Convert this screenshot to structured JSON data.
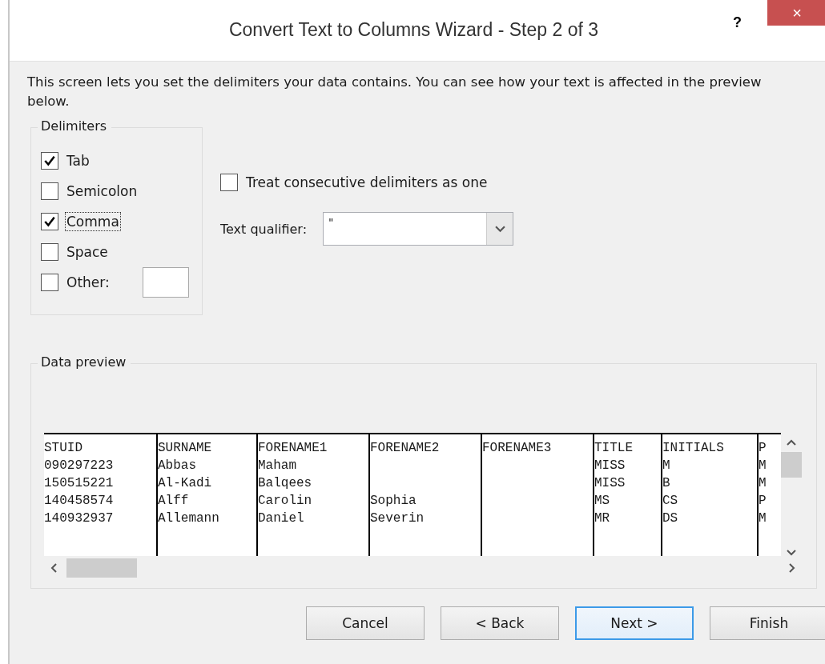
{
  "window": {
    "title": "Convert Text to Columns Wizard - Step 2 of 3",
    "help": "?",
    "close": "×"
  },
  "intro": "This screen lets you set the delimiters your data contains.  You can see how your text is affected in the preview below.",
  "delimiters": {
    "legend": "Delimiters",
    "items": [
      {
        "label": "Tab",
        "checked": true,
        "focused": false
      },
      {
        "label": "Semicolon",
        "checked": false,
        "focused": false
      },
      {
        "label": "Comma",
        "checked": true,
        "focused": true
      },
      {
        "label": "Space",
        "checked": false,
        "focused": false
      },
      {
        "label": "Other:",
        "checked": false,
        "focused": false
      }
    ]
  },
  "consecutive": {
    "label": "Treat consecutive delimiters as one",
    "checked": false
  },
  "qualifier": {
    "label": "Text qualifier:",
    "value": "\""
  },
  "preview": {
    "legend": "Data preview",
    "rows": [
      [
        "STUID",
        "SURNAME",
        "FORENAME1",
        "FORENAME2",
        "FORENAME3",
        "TITLE",
        "INITIALS",
        "P"
      ],
      [
        "090297223",
        "Abbas",
        "Maham",
        "",
        "",
        "MISS",
        "M",
        "M"
      ],
      [
        "150515221",
        "Al-Kadi",
        "Balqees",
        "",
        "",
        "MISS",
        "B",
        "M"
      ],
      [
        "140458574",
        "Alff",
        "Carolin",
        "Sophia",
        "",
        "MS",
        "CS",
        "P"
      ],
      [
        "140932937",
        "Allemann",
        "Daniel",
        "Severin",
        "",
        "MR",
        "DS",
        "M"
      ]
    ]
  },
  "buttons": [
    {
      "label": "Cancel",
      "default": false
    },
    {
      "label": "< Back",
      "default": false
    },
    {
      "label": "Next >",
      "default": true
    },
    {
      "label": "Finish",
      "default": false
    }
  ]
}
